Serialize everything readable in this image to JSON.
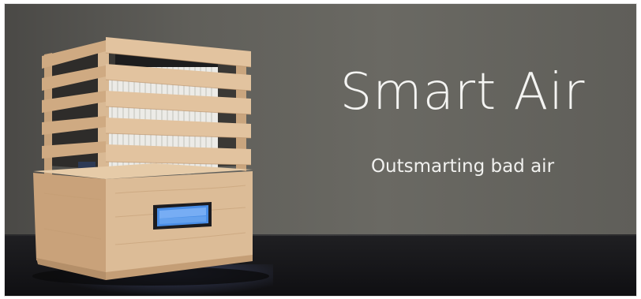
{
  "image": {
    "headline": "Smart Air",
    "tagline": "Outsmarting bad air",
    "subject": "wooden air purifier with slatted top and LCD display",
    "palette": {
      "wall": "#65645f",
      "table": "#17171a",
      "wood_light": "#e3c7a4",
      "wood_mid": "#cfae88",
      "wood_dark": "#b48f69",
      "filter": "#e8e6e2",
      "lcd": "#4f8fe0"
    }
  }
}
